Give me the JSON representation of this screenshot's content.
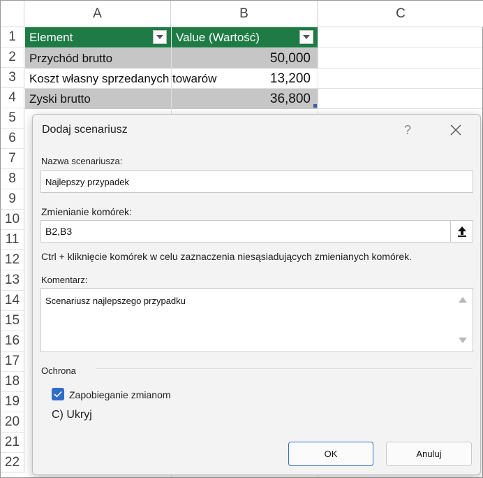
{
  "sheet": {
    "columns": [
      "A",
      "B",
      "C"
    ],
    "rows": [
      "1",
      "2",
      "3",
      "4",
      "5",
      "6",
      "7",
      "8",
      "9",
      "10",
      "11",
      "12",
      "13",
      "14",
      "15",
      "16",
      "17",
      "18",
      "19",
      "20",
      "21",
      "22"
    ],
    "table": {
      "header": {
        "element": "Element",
        "value": "Value (Wartość)"
      },
      "rows": [
        {
          "element": "Przychód brutto",
          "value": "50,000"
        },
        {
          "element": "Koszt własny sprzedanych towarów",
          "value": "13,200"
        },
        {
          "element": "Zyski brutto",
          "value": "36,800"
        }
      ]
    },
    "colors": {
      "header_bg": "#1e7b45",
      "band_bg": "#c6c6c6",
      "resize_handle": "#3a5fa8"
    }
  },
  "dialog": {
    "title": "Dodaj scenariusz",
    "help_glyph": "?",
    "name_label": "Nazwa scenariusza:",
    "name_value": "Najlepszy przypadek",
    "changing_label": "Zmienianie komórek:",
    "changing_value": "B2,B3",
    "hint": "Ctrl + kliknięcie komórek w celu zaznaczenia niesąsiadujących zmienianych komórek.",
    "comment_label": "Komentarz:",
    "comment_value": "Scenariusz najlepszego przypadku",
    "protection_label": "Ochrona",
    "prevent_changes_label": "Zapobieganie zmianom",
    "prevent_changes_checked": true,
    "hide_label": "C) Ukryj",
    "ok_label": "OK",
    "cancel_label": "Anuluj",
    "colors": {
      "checkbox": "#2f6dc9",
      "primary_border": "#2f6dc9"
    },
    "icons": {
      "collapse": "upload-arrow-icon",
      "close": "close-icon",
      "help": "help-icon"
    }
  }
}
